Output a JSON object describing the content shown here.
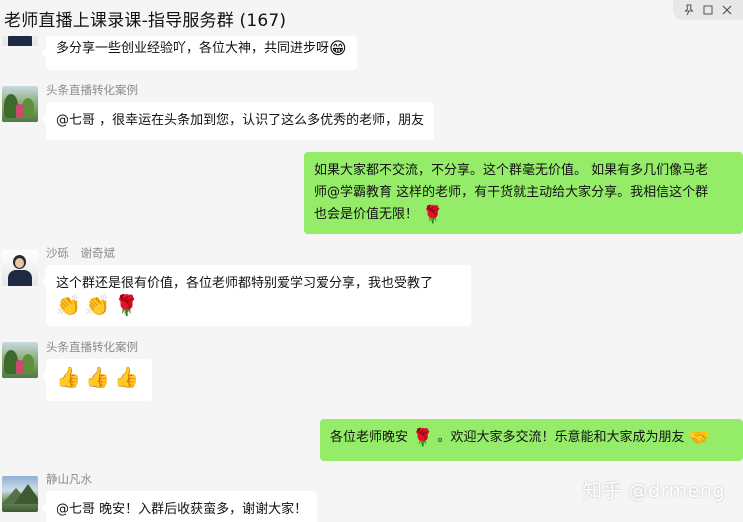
{
  "window": {
    "title": "老师直播上课录课-指导服务群 (167)",
    "controls": [
      "pin-icon",
      "maximize-icon",
      "close-icon"
    ]
  },
  "messages": [
    {
      "side": "left",
      "sender": "",
      "text": "多分享一些创业经验吖，各位大神，共同进步呀",
      "emoji": "😁"
    },
    {
      "side": "left",
      "sender": "头条直播转化案例",
      "text": "@七哥 ，很幸运在头条加到您，认识了这么多优秀的老师，朋友"
    },
    {
      "side": "right",
      "lines": [
        "如果大家都不交流，不分享。这个群毫无价值。 如果有多几们像马老",
        "师@学霸教育 这样的老师，有干货就主动给大家分享。我相信这个群",
        "也会是价值无限！"
      ],
      "emoji": "🌹"
    },
    {
      "side": "left",
      "sender": "沙砾　谢奇斌",
      "text": "这个群还是很有价值，各位老师都特别爱学习爱分享，我也受教了",
      "emojis": [
        "👏",
        "👏",
        "🌹"
      ]
    },
    {
      "side": "left",
      "sender": "头条直播转化案例",
      "emojis": [
        "👍",
        "👍",
        "👍"
      ]
    },
    {
      "side": "right",
      "text_before": "各位老师晚安",
      "emoji_mid": "🌹",
      "text_after": "。欢迎大家多交流！乐意能和大家成为朋友",
      "emoji_end": "🤝"
    },
    {
      "side": "left",
      "sender": "静山凡水",
      "text": "@七哥 晚安！入群后收获蛮多，谢谢大家！"
    }
  ],
  "watermark": "知乎 @drmeng",
  "colors": {
    "background": "#f5f5f5",
    "left_bubble": "#ffffff",
    "right_bubble": "#95ec69",
    "sender_name": "#8c8c8c"
  }
}
